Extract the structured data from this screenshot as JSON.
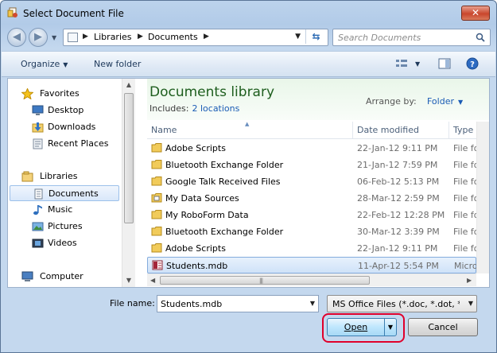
{
  "window": {
    "title": "Select Document File",
    "close_label": "✕"
  },
  "address": {
    "segments": [
      "Libraries",
      "Documents"
    ],
    "search_placeholder": "Search Documents"
  },
  "toolbar": {
    "organize_label": "Organize",
    "new_folder_label": "New folder"
  },
  "nav": {
    "items": [
      {
        "label": "Favorites",
        "icon": "star-icon"
      },
      {
        "label": "Desktop",
        "icon": "desktop-icon"
      },
      {
        "label": "Downloads",
        "icon": "downloads-icon"
      },
      {
        "label": "Recent Places",
        "icon": "recent-places-icon"
      },
      {
        "label": "Libraries",
        "icon": "libraries-icon"
      },
      {
        "label": "Documents",
        "icon": "documents-icon",
        "selected": true
      },
      {
        "label": "Music",
        "icon": "music-icon"
      },
      {
        "label": "Pictures",
        "icon": "pictures-icon"
      },
      {
        "label": "Videos",
        "icon": "videos-icon"
      },
      {
        "label": "Computer",
        "icon": "computer-icon"
      }
    ]
  },
  "library": {
    "title": "Documents library",
    "includes_label": "Includes:",
    "includes_link": "2 locations",
    "arrange_label": "Arrange by:",
    "arrange_value": "Folder"
  },
  "columns": {
    "name": "Name",
    "date": "Date modified",
    "type": "Type"
  },
  "files": [
    {
      "name": "Adobe Scripts",
      "date": "22-Jan-12 9:11 PM",
      "type": "File fol",
      "icon": "folder-icon"
    },
    {
      "name": "Bluetooth Exchange Folder",
      "date": "21-Jan-12 7:59 PM",
      "type": "File fol",
      "icon": "folder-icon"
    },
    {
      "name": "Google Talk Received Files",
      "date": "06-Feb-12 5:13 PM",
      "type": "File fol",
      "icon": "folder-icon"
    },
    {
      "name": "My Data Sources",
      "date": "28-Mar-12 2:59 PM",
      "type": "File fol",
      "icon": "data-sources-folder-icon"
    },
    {
      "name": "My RoboForm Data",
      "date": "22-Feb-12 12:28 PM",
      "type": "File fol",
      "icon": "folder-icon"
    },
    {
      "name": "Bluetooth Exchange Folder",
      "date": "30-Mar-12 3:39 PM",
      "type": "File fol",
      "icon": "folder-icon"
    },
    {
      "name": "Adobe Scripts",
      "date": "22-Jan-12 9:11 PM",
      "type": "File fol",
      "icon": "folder-icon"
    },
    {
      "name": "Students.mdb",
      "date": "11-Apr-12 5:54 PM",
      "type": "Micros",
      "icon": "access-database-icon",
      "selected": true
    }
  ],
  "footer": {
    "filename_label": "File name:",
    "filename_value": "Students.mdb",
    "filetype_value": "MS Office Files (*.doc, *.dot, *.x",
    "open_label": "Open",
    "cancel_label": "Cancel"
  },
  "colors": {
    "highlight": "#e0002b",
    "library_title": "#1e5e1e",
    "link": "#1a5bb5"
  }
}
